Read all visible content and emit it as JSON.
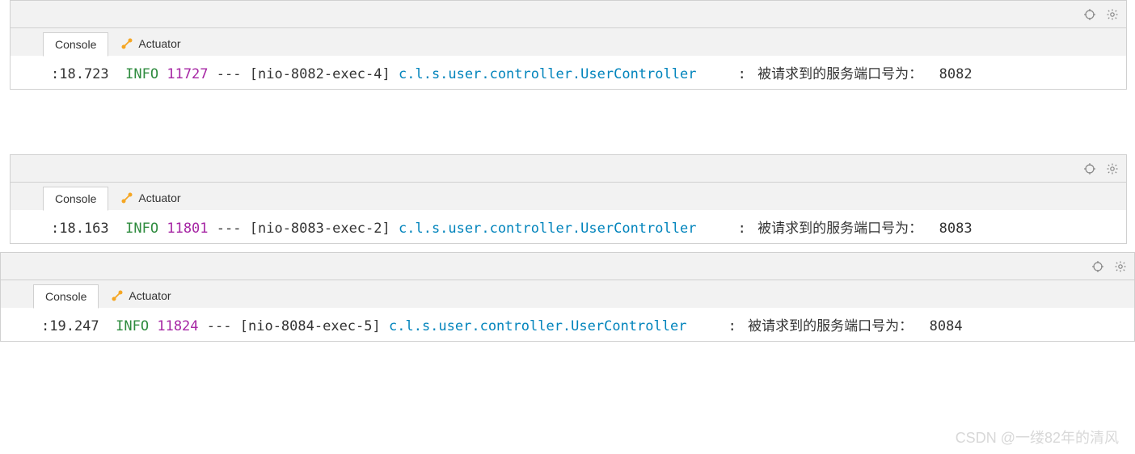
{
  "tabs": {
    "console": "Console",
    "actuator": "Actuator"
  },
  "panels": [
    {
      "timestamp": ":18.723",
      "level": "INFO",
      "pid": "11727",
      "separator": "---",
      "thread": "[nio-8082-exec-4]",
      "logger": "c.l.s.user.controller.UserController",
      "colon": ":",
      "message": "被请求到的服务端口号为：",
      "port": "8082"
    },
    {
      "timestamp": ":18.163",
      "level": "INFO",
      "pid": "11801",
      "separator": "---",
      "thread": "[nio-8083-exec-2]",
      "logger": "c.l.s.user.controller.UserController",
      "colon": ":",
      "message": "被请求到的服务端口号为：",
      "port": "8083"
    },
    {
      "timestamp": ":19.247",
      "level": "INFO",
      "pid": "11824",
      "separator": "---",
      "thread": "[nio-8084-exec-5]",
      "logger": "c.l.s.user.controller.UserController",
      "colon": ":",
      "message": "被请求到的服务端口号为：",
      "port": "8084"
    }
  ],
  "watermark": "CSDN @一缕82年的清风"
}
